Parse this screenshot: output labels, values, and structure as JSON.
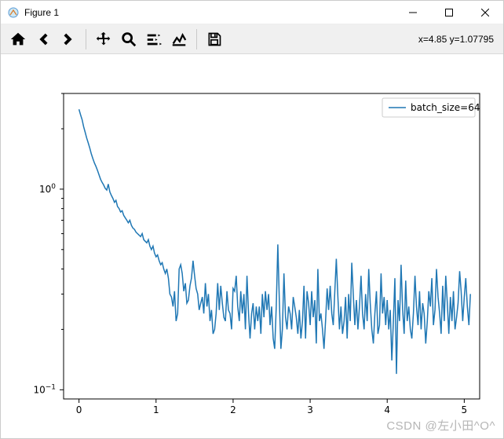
{
  "window": {
    "title": "Figure 1"
  },
  "toolbar": {
    "coord_text": "x=4.85 y=1.07795"
  },
  "watermark": {
    "text": "CSDN @左小田^O^"
  },
  "chart_data": {
    "type": "line",
    "xlabel": "",
    "ylabel": "",
    "xlim": [
      -0.2,
      5.2
    ],
    "ylim_log": [
      0.09,
      3.0
    ],
    "yscale": "log",
    "xticks": [
      0,
      1,
      2,
      3,
      4,
      5
    ],
    "yticks": [
      0.1,
      1.0
    ],
    "ytick_labels": [
      "10⁻¹",
      "10⁰"
    ],
    "legend": {
      "position": "upper right",
      "entries": [
        "batch_size=64"
      ]
    },
    "series": [
      {
        "name": "batch_size=64",
        "color": "#1f77b4",
        "x_step": 0.02,
        "values": [
          2.5,
          2.35,
          2.22,
          2.05,
          1.92,
          1.8,
          1.7,
          1.6,
          1.5,
          1.42,
          1.35,
          1.3,
          1.24,
          1.18,
          1.12,
          1.08,
          1.05,
          1.01,
          0.99,
          1.06,
          0.97,
          0.93,
          0.9,
          0.86,
          0.88,
          0.82,
          0.8,
          0.77,
          0.78,
          0.74,
          0.72,
          0.7,
          0.68,
          0.7,
          0.66,
          0.64,
          0.63,
          0.61,
          0.6,
          0.59,
          0.58,
          0.6,
          0.56,
          0.55,
          0.54,
          0.56,
          0.52,
          0.5,
          0.52,
          0.48,
          0.46,
          0.47,
          0.44,
          0.42,
          0.43,
          0.4,
          0.38,
          0.4,
          0.36,
          0.3,
          0.29,
          0.26,
          0.31,
          0.22,
          0.24,
          0.4,
          0.42,
          0.38,
          0.31,
          0.34,
          0.27,
          0.28,
          0.33,
          0.36,
          0.44,
          0.37,
          0.32,
          0.3,
          0.25,
          0.27,
          0.29,
          0.24,
          0.34,
          0.26,
          0.3,
          0.22,
          0.25,
          0.19,
          0.2,
          0.24,
          0.34,
          0.25,
          0.33,
          0.27,
          0.23,
          0.22,
          0.31,
          0.25,
          0.24,
          0.2,
          0.32,
          0.31,
          0.37,
          0.26,
          0.22,
          0.31,
          0.24,
          0.3,
          0.2,
          0.37,
          0.24,
          0.18,
          0.24,
          0.27,
          0.2,
          0.26,
          0.22,
          0.26,
          0.19,
          0.3,
          0.23,
          0.31,
          0.25,
          0.3,
          0.21,
          0.26,
          0.18,
          0.16,
          0.26,
          0.53,
          0.28,
          0.16,
          0.2,
          0.38,
          0.23,
          0.2,
          0.26,
          0.24,
          0.2,
          0.29,
          0.26,
          0.23,
          0.19,
          0.25,
          0.18,
          0.22,
          0.33,
          0.18,
          0.31,
          0.27,
          0.21,
          0.31,
          0.23,
          0.28,
          0.17,
          0.4,
          0.22,
          0.24,
          0.2,
          0.16,
          0.22,
          0.32,
          0.25,
          0.33,
          0.24,
          0.21,
          0.31,
          0.45,
          0.29,
          0.2,
          0.26,
          0.19,
          0.22,
          0.29,
          0.18,
          0.3,
          0.22,
          0.43,
          0.3,
          0.21,
          0.28,
          0.2,
          0.26,
          0.37,
          0.24,
          0.2,
          0.3,
          0.22,
          0.4,
          0.27,
          0.2,
          0.17,
          0.24,
          0.31,
          0.19,
          0.21,
          0.38,
          0.24,
          0.29,
          0.21,
          0.28,
          0.2,
          0.25,
          0.14,
          0.22,
          0.36,
          0.12,
          0.28,
          0.22,
          0.42,
          0.25,
          0.19,
          0.35,
          0.22,
          0.26,
          0.2,
          0.18,
          0.24,
          0.37,
          0.26,
          0.21,
          0.31,
          0.2,
          0.27,
          0.24,
          0.17,
          0.22,
          0.31,
          0.26,
          0.36,
          0.21,
          0.25,
          0.4,
          0.29,
          0.24,
          0.19,
          0.33,
          0.22,
          0.37,
          0.27,
          0.19,
          0.29,
          0.22,
          0.31,
          0.2,
          0.23,
          0.27,
          0.39,
          0.31,
          0.22,
          0.29,
          0.36,
          0.26,
          0.21,
          0.3
        ]
      }
    ]
  }
}
